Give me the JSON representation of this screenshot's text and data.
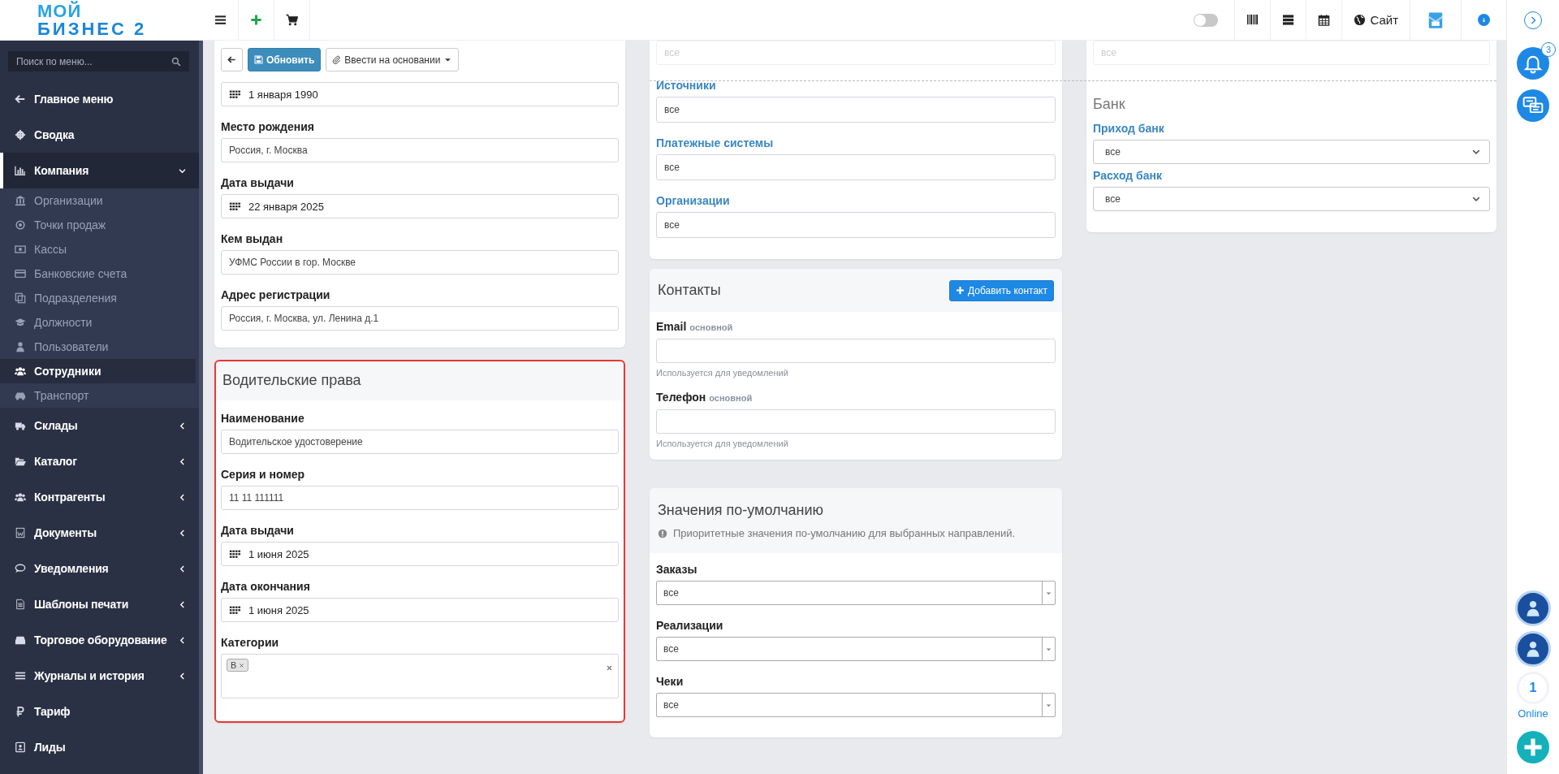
{
  "logo": {
    "line_1": "МОЙ",
    "line_2": "БИЗНЕС 2"
  },
  "topbar": {
    "toggle": {
      "on": false
    },
    "site_link": "Сайт"
  },
  "sidebar": {
    "search": {
      "placeholder": "Поиск по меню..."
    },
    "items": [
      {
        "label": "Главное меню",
        "kind": "link",
        "selected": false
      },
      {
        "label": "Сводка",
        "kind": "link",
        "selected": false
      },
      {
        "label": "Компания",
        "kind": "group",
        "expanded": true,
        "selected": true,
        "children": [
          {
            "label": "Организации",
            "selected": false
          },
          {
            "label": "Точки продаж",
            "selected": false
          },
          {
            "label": "Кассы",
            "selected": false
          },
          {
            "label": "Банковские счета",
            "selected": false
          },
          {
            "label": "Подразделения",
            "selected": false
          },
          {
            "label": "Должности",
            "selected": false
          },
          {
            "label": "Пользователи",
            "selected": false
          },
          {
            "label": "Сотрудники",
            "selected": true
          },
          {
            "label": "Транспорт",
            "selected": false
          }
        ]
      },
      {
        "label": "Склады",
        "kind": "group",
        "expanded": false,
        "selected": false
      },
      {
        "label": "Каталог",
        "kind": "group",
        "expanded": false,
        "selected": false
      },
      {
        "label": "Контрагенты",
        "kind": "group",
        "expanded": false,
        "selected": false
      },
      {
        "label": "Документы",
        "kind": "group",
        "expanded": false,
        "selected": false
      },
      {
        "label": "Уведомления",
        "kind": "group",
        "expanded": false,
        "selected": false
      },
      {
        "label": "Шаблоны печати",
        "kind": "group",
        "expanded": false,
        "selected": false
      },
      {
        "label": "Торговое оборудование",
        "kind": "group",
        "expanded": false,
        "selected": false
      },
      {
        "label": "Журналы и история",
        "kind": "group",
        "expanded": false,
        "selected": false
      },
      {
        "label": "Тариф",
        "kind": "link",
        "selected": false
      },
      {
        "label": "Лиды",
        "kind": "link",
        "selected": false
      }
    ]
  },
  "toolbar": {
    "update_button": "Обновить",
    "base_on_button": "Ввести на основании"
  },
  "passport_card": {
    "fields": [
      {
        "kind": "date",
        "value": "1 января 1990"
      },
      {
        "kind": "text",
        "label": "Место рождения",
        "value": "Россия, г. Москва"
      },
      {
        "kind": "date",
        "label": "Дата выдачи",
        "value": "22 января 2025"
      },
      {
        "kind": "text",
        "label": "Кем выдан",
        "value": "УФМС России в гор. Москве"
      },
      {
        "kind": "text",
        "label": "Адрес регистрации",
        "value": "Россия, г. Москва, ул. Ленина д.1"
      }
    ]
  },
  "license_card": {
    "title": "Водительские права",
    "highlighted": true,
    "fields": [
      {
        "kind": "text",
        "label": "Наименование",
        "value": "Водительское удостоверение"
      },
      {
        "kind": "text",
        "label": "Серия и номер",
        "value": "11 11 111111"
      },
      {
        "kind": "date",
        "label": "Дата выдачи",
        "value": "1 июня 2025"
      },
      {
        "kind": "date",
        "label": "Дата окончания",
        "value": "1 июня 2025"
      },
      {
        "kind": "tags",
        "label": "Категории",
        "tags": [
          "B"
        ]
      }
    ]
  },
  "filters_card": {
    "top_select": "все",
    "fields": [
      {
        "kind": "text",
        "label": "Источники",
        "value": "все"
      },
      {
        "kind": "text",
        "label": "Платежные системы",
        "value": "все"
      },
      {
        "kind": "text",
        "label": "Организации",
        "value": "все"
      }
    ]
  },
  "contacts_card": {
    "title": "Контакты",
    "add_button": "Добавить контакт",
    "fields": [
      {
        "label": "Email",
        "tag": "основной",
        "hint": "Используется для уведомлений"
      },
      {
        "label": "Телефон",
        "tag": "основной",
        "hint": "Используется для уведомлений"
      }
    ]
  },
  "defaults_card": {
    "title": "Значения по-умолчанию",
    "info": "Приоритетные значения по-умолчанию для выбранных направлений.",
    "fields": [
      {
        "kind": "combo",
        "label": "Заказы",
        "value": "все"
      },
      {
        "kind": "combo",
        "label": "Реализации",
        "value": "все"
      },
      {
        "kind": "combo",
        "label": "Чеки",
        "value": "все"
      }
    ]
  },
  "bank_card": {
    "top_select": "все",
    "title": "Банк",
    "fields": [
      {
        "kind": "select",
        "label": "Приход банк",
        "value": "все"
      },
      {
        "kind": "select",
        "label": "Расход банк",
        "value": "все"
      }
    ]
  },
  "rail": {
    "notifications_badge": "3",
    "online_count": "1",
    "online_label": "Online"
  }
}
